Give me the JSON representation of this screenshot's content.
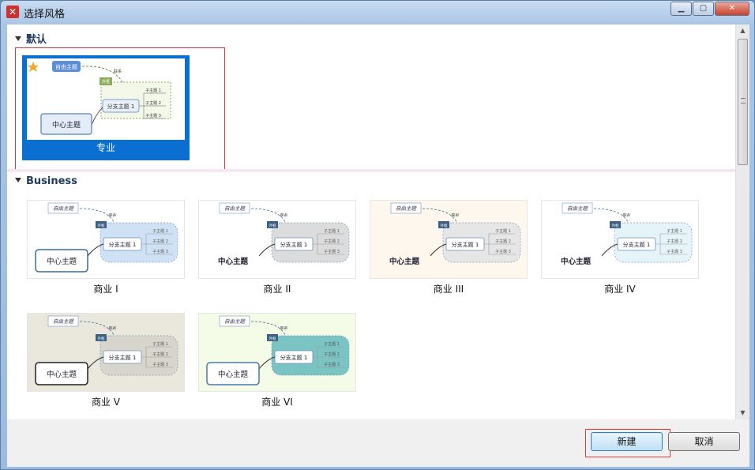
{
  "window": {
    "title": "选择风格",
    "app_icon": "xmind-icon",
    "controls": [
      "minimize",
      "maximize",
      "close"
    ]
  },
  "sections": {
    "default": {
      "header": "默认"
    },
    "business": {
      "header": "Business"
    }
  },
  "featured": {
    "label": "专业",
    "selected": true,
    "preview": {
      "float": "自由主题",
      "relation": "联系",
      "summary": "外框",
      "branch": "分支主题 1",
      "central": "中心主题",
      "subs": [
        "子主题 1",
        "子主题 2",
        "子主题 3"
      ]
    }
  },
  "themes": [
    {
      "label": "商业 I",
      "float": "自由主题",
      "relation": "联系",
      "summary": "外框",
      "branch": "分支主题 1",
      "central": "中心主题",
      "subs": [
        "子主题 1",
        "子主题 2",
        "子主题 3"
      ]
    },
    {
      "label": "商业 II",
      "float": "自由主题",
      "relation": "联系",
      "summary": "外框",
      "branch": "分支主题 1",
      "central": "中心主题",
      "subs": [
        "子主题 1",
        "子主题 2",
        "子主题 3"
      ]
    },
    {
      "label": "商业 III",
      "float": "自由主题",
      "relation": "联系",
      "summary": "外框",
      "branch": "分支主题 1",
      "central": "中心主题",
      "subs": [
        "子主题 1",
        "子主题 2",
        "子主题 3"
      ]
    },
    {
      "label": "商业 IV",
      "float": "自由主题",
      "relation": "联系",
      "summary": "外框",
      "branch": "分支主题 1",
      "central": "中心主题",
      "subs": [
        "子主题 1",
        "子主题 2",
        "子主题 3"
      ]
    },
    {
      "label": "商业 V",
      "float": "自由主题",
      "relation": "联系",
      "summary": "外框",
      "branch": "分支主题 1",
      "central": "中心主题",
      "subs": [
        "子主题 1",
        "子主题 2",
        "子主题 3"
      ]
    },
    {
      "label": "商业 VI",
      "float": "自由主题",
      "relation": "联系",
      "summary": "外框",
      "branch": "分支主题 1",
      "central": "中心主题",
      "subs": [
        "子主题 1",
        "子主题 2",
        "子主题 3"
      ]
    }
  ],
  "buttons": {
    "new": "新建",
    "cancel": "取消"
  },
  "colors": {
    "featured_bg": "#0a6fd0",
    "selection_frame": "#d9383a",
    "accent": "#1f3a5c"
  }
}
